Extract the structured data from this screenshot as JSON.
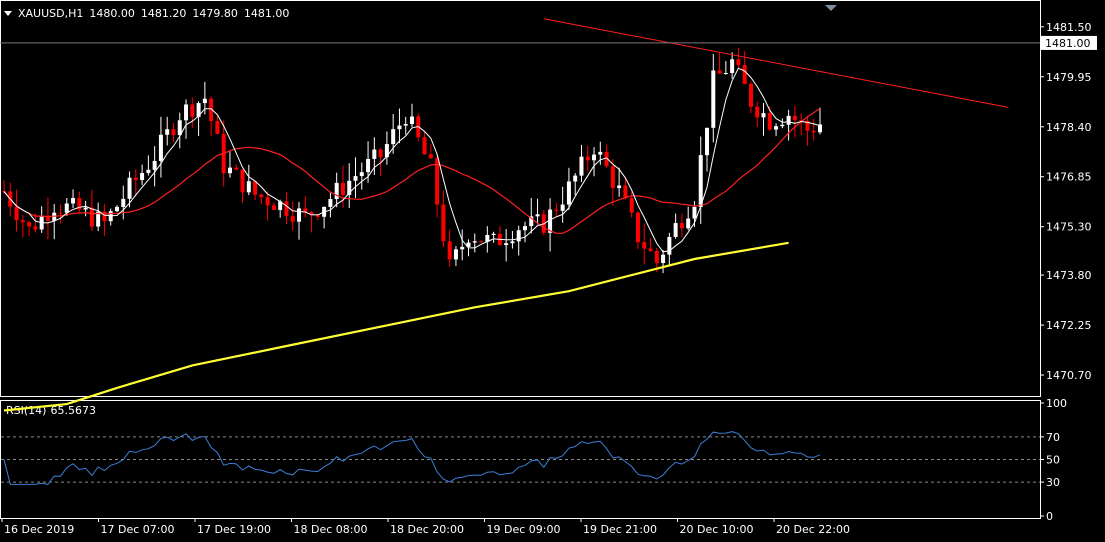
{
  "header": {
    "symbol_tf": "XAUUSD,H1",
    "o": "1480.00",
    "h": "1481.20",
    "l": "1479.80",
    "c": "1481.00"
  },
  "rsi_header": {
    "name": "RSI(14)",
    "value": "65.5673"
  },
  "colors": {
    "background": "#000000",
    "bull_candle": "#ffffff",
    "bear_candle": "#ff0000",
    "ma_fast": "#ffffff",
    "ma_slow": "#ff2020",
    "ma_long": "#ffff33",
    "trendline": "#ff2020",
    "rsi_line": "#3d7fd6",
    "grid": "#8a8a8a"
  },
  "chart_data": [
    {
      "type": "candlestick",
      "symbol": "XAUUSD",
      "timeframe": "H1",
      "y_ticks": [
        1481.5,
        1479.95,
        1478.4,
        1476.85,
        1475.3,
        1473.8,
        1472.25,
        1470.7
      ],
      "ylim": [
        1470.05,
        1482.3
      ],
      "current_price": "1481.00",
      "x_ticks": [
        "16 Dec 2019",
        "17 Dec 07:00",
        "17 Dec 19:00",
        "18 Dec 08:00",
        "18 Dec 20:00",
        "19 Dec 09:00",
        "19 Dec 21:00",
        "20 Dec 10:00",
        "20 Dec 22:00"
      ],
      "ma_long": [
        [
          0,
          1469.6
        ],
        [
          10,
          1469.8
        ],
        [
          18,
          1470.3
        ],
        [
          30,
          1471.0
        ],
        [
          45,
          1471.6
        ],
        [
          60,
          1472.2
        ],
        [
          75,
          1472.8
        ],
        [
          90,
          1473.3
        ],
        [
          100,
          1473.8
        ],
        [
          110,
          1474.3
        ],
        [
          125,
          1474.8
        ]
      ],
      "trendline": [
        [
          86,
          1481.75
        ],
        [
          160,
          1479.0
        ]
      ]
    },
    {
      "type": "line",
      "title": "RSI(14) 65.5673",
      "y_ticks": [
        100,
        70,
        50,
        30,
        0
      ],
      "levels": [
        70,
        50,
        30
      ],
      "ylim": [
        0,
        100
      ]
    }
  ]
}
